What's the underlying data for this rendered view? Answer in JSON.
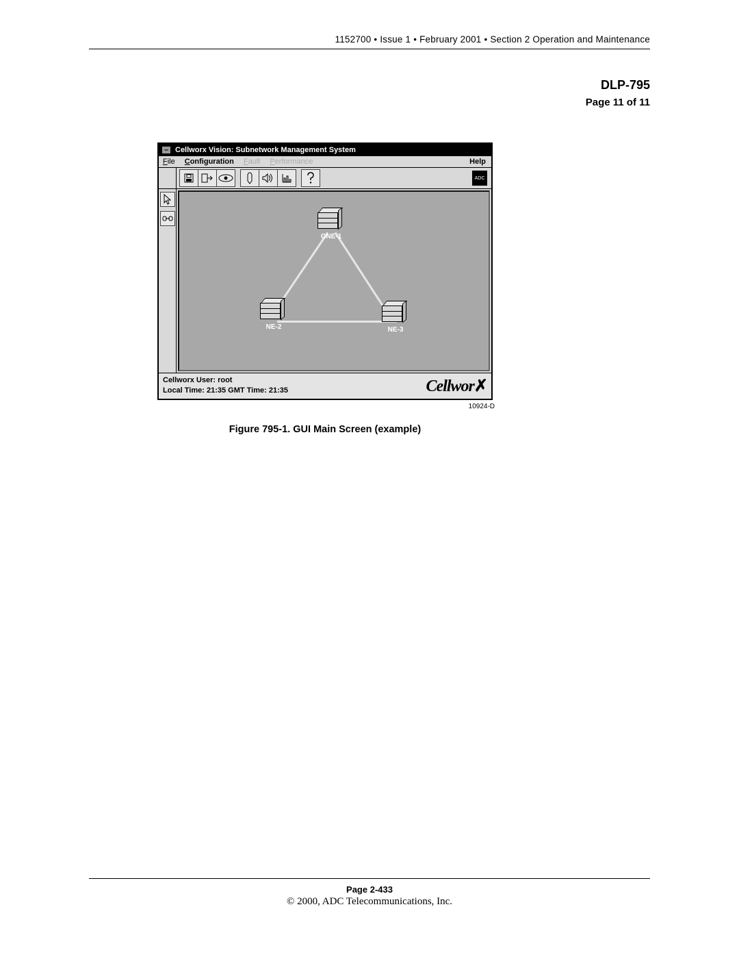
{
  "header": {
    "doc_id": "1152700",
    "issue": "Issue 1",
    "date": "February 2001",
    "section": "Section 2 Operation and Maintenance"
  },
  "title": "DLP-795",
  "page_of": "Page 11 of 11",
  "app": {
    "window_title": "Cellworx Vision:  Subnetwork Management System",
    "menu": {
      "file": "File",
      "configuration": "Configuration",
      "fault": "Fault",
      "performance": "Performance",
      "help": "Help"
    },
    "adc_label": "ADC",
    "nodes": {
      "gne1": "GNE-1",
      "ne2": "NE-2",
      "ne3": "NE-3"
    },
    "status": {
      "user_line": "Cellworx User:  root",
      "time_line": "Local Time: 21:35  GMT Time:  21:35"
    },
    "logo_text": "Cellworx"
  },
  "figure": {
    "ref": "10924-D",
    "caption": "Figure 795-1. GUI Main Screen (example)"
  },
  "footer": {
    "page": "Page 2-433",
    "copyright": "© 2000, ADC Telecommunications, Inc."
  }
}
